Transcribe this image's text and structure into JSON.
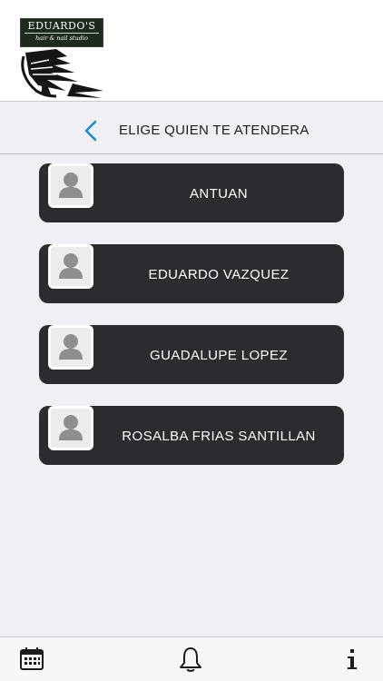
{
  "logo": {
    "name": "EDUARDO'S",
    "tagline": "hair & nail studio"
  },
  "nav": {
    "title": "ELIGE QUIEN TE ATENDERA",
    "back_icon": "chevron-left-icon"
  },
  "staff": [
    {
      "name": "ANTUAN"
    },
    {
      "name": "EDUARDO VAZQUEZ"
    },
    {
      "name": "GUADALUPE LOPEZ"
    },
    {
      "name": "ROSALBA FRIAS SANTILLAN"
    }
  ],
  "tabs": [
    {
      "icon": "calendar-icon"
    },
    {
      "icon": "bell-icon"
    },
    {
      "icon": "info-icon"
    }
  ],
  "colors": {
    "accent": "#1e88c8",
    "card": "#2c2c2e",
    "background": "#efeff4"
  }
}
